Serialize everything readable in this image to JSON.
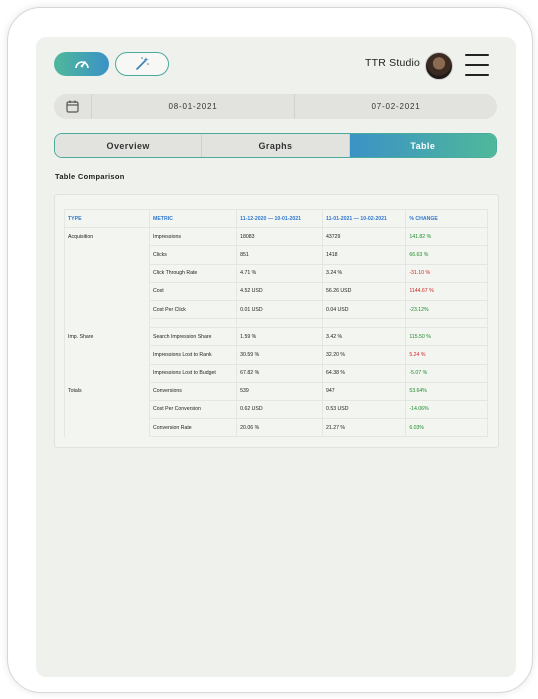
{
  "header": {
    "studio_name": "TTR Studio",
    "icons": [
      "speedometer-icon",
      "magic-wand-icon",
      "calendar-icon",
      "hamburger-menu-icon"
    ]
  },
  "dates": {
    "start": "08-01-2021",
    "end": "07-02-2021"
  },
  "tabs": [
    "Overview",
    "Graphs",
    "Table"
  ],
  "active_tab": "Table",
  "section_title": "Table Comparison",
  "table": {
    "headers": [
      "TYPE",
      "METRIC",
      "11-12-2020 — 10-01-2021",
      "11-01-2021 — 10-02-2021",
      "% CHANGE"
    ],
    "rows": [
      [
        "Acquisition",
        "Impressions",
        "18083",
        "43729",
        "141.82 %"
      ],
      [
        "",
        "Clicks",
        "851",
        "1418",
        "66.63 %"
      ],
      [
        "",
        "Click Through Rate",
        "4.71 %",
        "3.24 %",
        "-31.10 %"
      ],
      [
        "",
        "Cost",
        "4.52 USD",
        "56.26 USD",
        "1144.67 %"
      ],
      [
        "",
        "Cost Per Click",
        "0.01 USD",
        "0.04 USD",
        "-23.12%"
      ],
      [
        "",
        "",
        "",
        "",
        ""
      ],
      [
        "Imp. Share",
        "Search Impression Share",
        "1.59 %",
        "3.42 %",
        "115.50 %"
      ],
      [
        "",
        "Impressions Lost to Rank",
        "30.59 %",
        "32.20 %",
        "5.24 %"
      ],
      [
        "",
        "Impressions Lost to Budget",
        "67.82 %",
        "64.38 %",
        "-5.07 %"
      ],
      [
        "Totals",
        "Conversions",
        "539",
        "947",
        "53.64%"
      ],
      [
        "",
        "Cost Per Conversion",
        "0.62 USD",
        "0.53 USD",
        "-14.06%"
      ],
      [
        "",
        "Conversion Rate",
        "20.06 %",
        "21.27 %",
        "6.03%"
      ]
    ],
    "change_colors": [
      "pos",
      "pos",
      "neg",
      "neg",
      "pos",
      "",
      "pos",
      "neg",
      "pos",
      "pos",
      "pos",
      "pos"
    ]
  },
  "colors": {
    "accent_green": "#4fb89a",
    "accent_blue": "#3b92c6",
    "positive": "#1c8a2a",
    "negative": "#d12424",
    "header_blue": "#2f77d0"
  }
}
